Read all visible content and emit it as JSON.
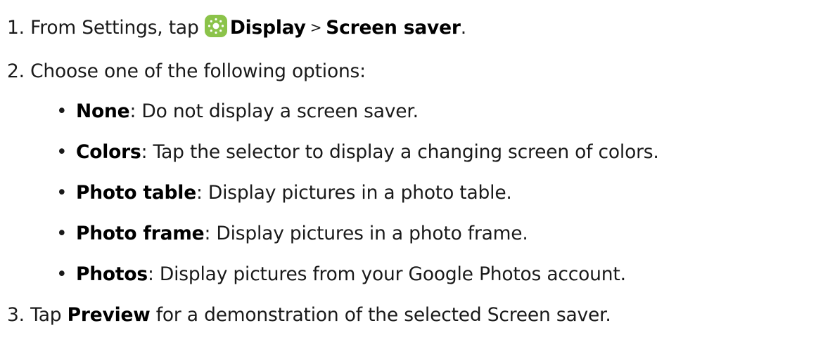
{
  "steps": [
    {
      "number": "1.",
      "prefix": "From Settings, tap",
      "icon": {
        "name": "display-brightness-icon",
        "bg_color": "#8bc34a"
      },
      "path_1": "Display",
      "separator": ">",
      "path_2": "Screen saver",
      "suffix": "."
    },
    {
      "number": "2.",
      "text": "Choose one of the following options:"
    },
    {
      "number": "3.",
      "prefix": "Tap",
      "bold": "Preview",
      "suffix": "for a demonstration of the selected Screen saver."
    }
  ],
  "options": [
    {
      "bullet": "•",
      "term": "None",
      "desc": ": Do not display a screen saver."
    },
    {
      "bullet": "•",
      "term": "Colors",
      "desc": ": Tap the selector to display a changing screen of colors."
    },
    {
      "bullet": "•",
      "term": "Photo table",
      "desc": ": Display pictures in a photo table."
    },
    {
      "bullet": "•",
      "term": "Photo frame",
      "desc": ": Display pictures in a photo frame."
    },
    {
      "bullet": "•",
      "term": "Photos",
      "desc": ": Display pictures from your Google Photos account."
    }
  ]
}
